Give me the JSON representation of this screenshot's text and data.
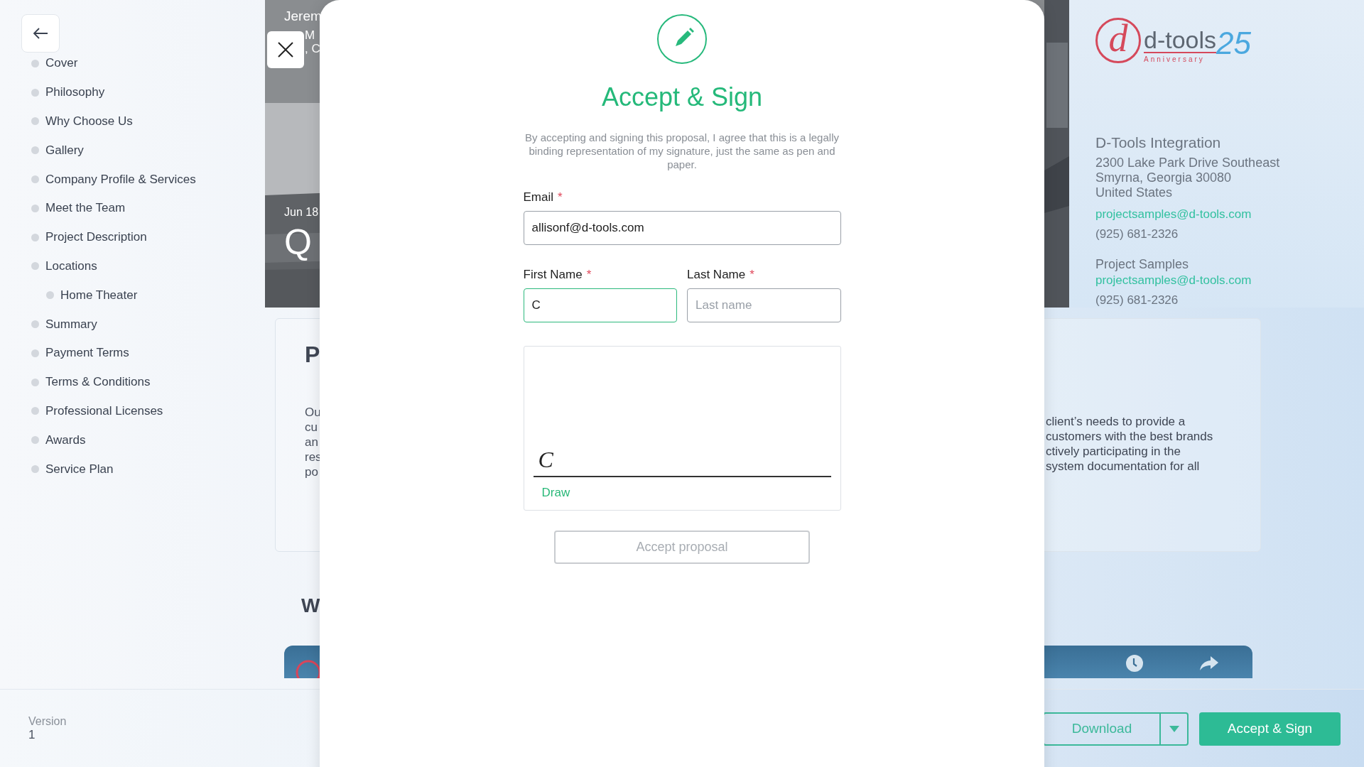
{
  "sidebar": {
    "items": [
      {
        "label": "Cover"
      },
      {
        "label": "Philosophy"
      },
      {
        "label": "Why Choose Us"
      },
      {
        "label": "Gallery"
      },
      {
        "label": "Company Profile & Services"
      },
      {
        "label": "Meet the Team"
      },
      {
        "label": "Project Description"
      },
      {
        "label": "Locations",
        "children": [
          {
            "label": "Home Theater"
          }
        ]
      },
      {
        "label": "Summary"
      },
      {
        "label": "Payment Terms"
      },
      {
        "label": "Terms & Conditions"
      },
      {
        "label": "Professional Licenses"
      },
      {
        "label": "Awards"
      },
      {
        "label": "Service Plan"
      }
    ]
  },
  "cover": {
    "client_name": "Jerem",
    "address_lines": [
      "M",
      ", C"
    ],
    "date": "Jun 18",
    "mark": "Q"
  },
  "company": {
    "logo": {
      "mark": "d",
      "name": "d-tools",
      "number": "25",
      "tagline": "Anniversary"
    },
    "name": "D-Tools Integration",
    "address_lines": [
      "2300 Lake Park Drive Southeast",
      "Smyrna, Georgia 30080",
      "United States"
    ],
    "email": "projectsamples@d-tools.com",
    "phone": "(925) 681-2326",
    "contact": {
      "name": "Project Samples",
      "email": "projectsamples@d-tools.com",
      "phone": "(925) 681-2326"
    }
  },
  "section": {
    "heading": "P",
    "left_lines": [
      "Ou",
      "cu",
      "an",
      "res",
      "po"
    ],
    "right_lines": [
      "client’s needs to provide a",
      "customers with the best brands",
      "ctively participating in the",
      "system documentation for all"
    ]
  },
  "section_2": {
    "heading": "W"
  },
  "footer": {
    "version_label": "Version",
    "version": "1",
    "download": "Download",
    "accept": "Accept & Sign"
  },
  "modal": {
    "title": "Accept & Sign",
    "description": "By accepting and signing this proposal, I agree that this is a legally binding representation of my signature, just the same as pen and paper.",
    "email": {
      "label": "Email",
      "required_mark": "*",
      "value": "allisonf@d-tools.com",
      "focused": false
    },
    "names": [
      {
        "label": "First Name",
        "required_mark": "*",
        "value": "C",
        "focused": true
      },
      {
        "label": "Last Name",
        "required_mark": "*",
        "placeholder": "Last name",
        "focused": false
      }
    ],
    "signature": {
      "text": "C",
      "mode": "Draw"
    },
    "submit": {
      "label": "Accept proposal",
      "disabled": true
    }
  }
}
